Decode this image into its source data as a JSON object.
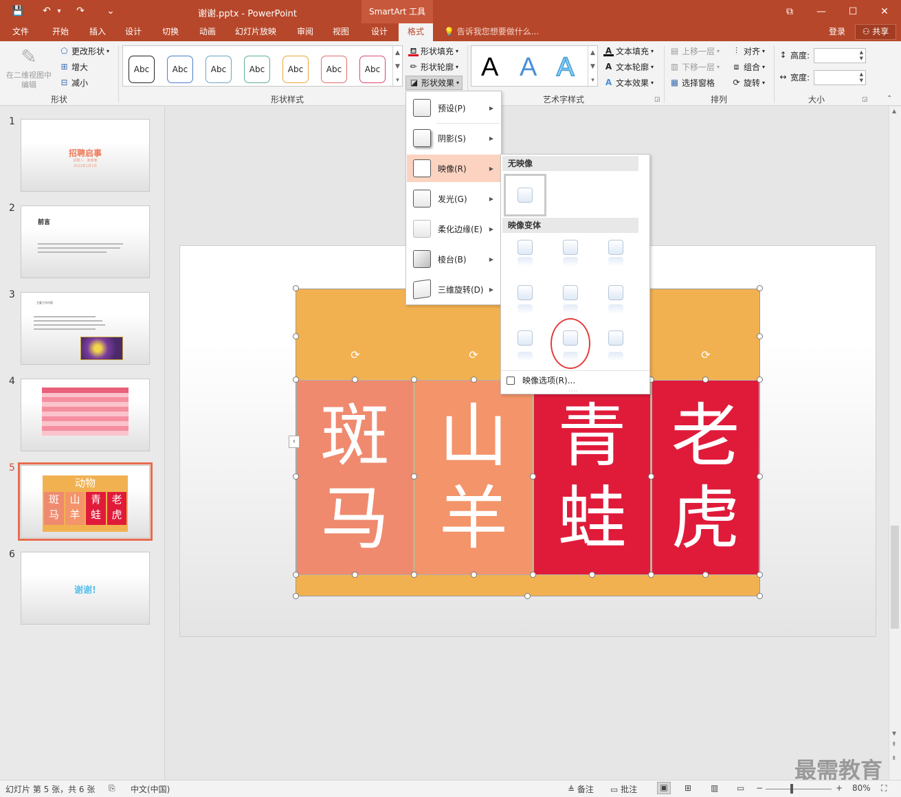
{
  "window": {
    "title": "谢谢.pptx - PowerPoint",
    "contextual_tab_group": "SmartArt 工具",
    "title_bar_color": "#b7472a",
    "quick_access": [
      {
        "icon": "save-icon",
        "glyph": "💾"
      },
      {
        "icon": "undo-icon",
        "glyph": "↶"
      },
      {
        "icon": "undo-dropdown-icon",
        "glyph": "▾"
      },
      {
        "icon": "redo-icon",
        "glyph": "↷"
      },
      {
        "icon": "customize-qat-icon",
        "glyph": "⌄"
      }
    ],
    "controls": [
      {
        "icon": "ribbon-display-options-icon",
        "glyph": "⧉"
      },
      {
        "icon": "minimize-icon",
        "glyph": "—"
      },
      {
        "icon": "maximize-icon",
        "glyph": "☐"
      },
      {
        "icon": "close-icon",
        "glyph": "✕"
      }
    ]
  },
  "tabs": [
    {
      "label": "文件",
      "active": false
    },
    {
      "label": "开始",
      "active": false
    },
    {
      "label": "插入",
      "active": false
    },
    {
      "label": "设计",
      "active": false
    },
    {
      "label": "切换",
      "active": false
    },
    {
      "label": "动画",
      "active": false
    },
    {
      "label": "幻灯片放映",
      "active": false
    },
    {
      "label": "审阅",
      "active": false
    },
    {
      "label": "视图",
      "active": false
    },
    {
      "label": "设计",
      "active": false
    },
    {
      "label": "格式",
      "active": true
    }
  ],
  "tell_me": "告诉我您想要做什么...",
  "login": "登录",
  "share": "共享",
  "ribbon": {
    "shapes_group": {
      "label": "形状",
      "edit_in_2d": "在二维视图中编辑",
      "change_shape": "更改形状",
      "larger": "增大",
      "smaller": "减小"
    },
    "shape_styles_group": {
      "label": "形状样式",
      "sample_text": "Abc",
      "style_colors": [
        "#222222",
        "#4a7cc9",
        "#6aa3c2",
        "#5aae8c",
        "#e8a538",
        "#e36a6a",
        "#d9476b"
      ],
      "fill": "形状填充",
      "outline": "形状轮廓",
      "effects": "形状效果"
    },
    "wordart_group": {
      "label": "艺术字样式",
      "sample_letter": "A",
      "text_fill": "文本填充",
      "text_outline": "文本轮廓",
      "text_effects": "文本效果"
    },
    "arrange_group": {
      "label": "排列",
      "bring_forward": "上移一层",
      "send_backward": "下移一层",
      "selection_pane": "选择窗格",
      "align": "对齐",
      "group": "组合",
      "rotate": "旋转"
    },
    "size_group": {
      "label": "大小",
      "height": "高度:",
      "width": "宽度:"
    }
  },
  "shape_effects_menu": [
    {
      "label": "预设(P)",
      "highlighted": false
    },
    {
      "label": "阴影(S)",
      "highlighted": false
    },
    {
      "label": "映像(R)",
      "highlighted": true
    },
    {
      "label": "发光(G)",
      "highlighted": false
    },
    {
      "label": "柔化边缘(E)",
      "highlighted": false
    },
    {
      "label": "棱台(B)",
      "highlighted": false
    },
    {
      "label": "三维旋转(D)",
      "highlighted": false
    }
  ],
  "reflection_panel": {
    "no_reflection_header": "无映像",
    "variations_header": "映像变体",
    "options": "映像选项(R)...",
    "selected_variation_row": 3,
    "selected_variation_col": 2
  },
  "slides": [
    {
      "number": "1",
      "title": "招聘启事",
      "line1": "招聘人：某某某",
      "line2": "2021年1月1日"
    },
    {
      "number": "2",
      "title": "前言"
    },
    {
      "number": "3",
      "title": "主要工作内容"
    },
    {
      "number": "4"
    },
    {
      "number": "5",
      "title": "动物",
      "items": [
        "斑马",
        "山羊",
        "青蛙",
        "老虎"
      ],
      "selected": true
    },
    {
      "number": "6",
      "title": "谢谢!"
    }
  ],
  "smartart": {
    "header_visible": "动",
    "header_color": "#f2b150",
    "cards": [
      {
        "top": "斑",
        "bottom": "马",
        "color": "#ef8a6f"
      },
      {
        "top": "山",
        "bottom": "羊",
        "color": "#f3946a"
      },
      {
        "top": "青",
        "bottom": "蛙",
        "color": "#e01b3a"
      },
      {
        "top": "老",
        "bottom": "虎",
        "color": "#e01b3a"
      }
    ]
  },
  "status_bar": {
    "slide_info": "幻灯片 第 5 张，共 6 张",
    "language": "中文(中国)",
    "notes": "备注",
    "comments": "批注",
    "zoom": "80%"
  },
  "watermark": "最需教育"
}
